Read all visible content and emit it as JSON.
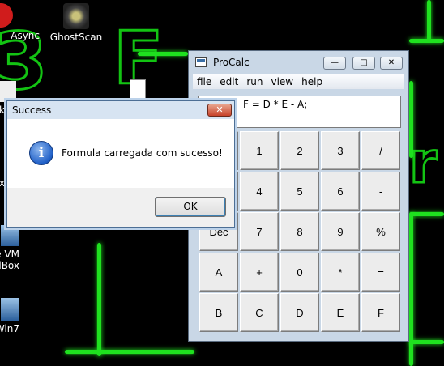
{
  "desktop": {
    "icons": [
      {
        "label": "Async",
        "icon": "async-app-icon"
      },
      {
        "label": "GhostScan",
        "icon": "ghostscan-app-icon"
      },
      {
        "label": "ck",
        "icon": "app-icon"
      },
      {
        "label": "ax",
        "icon": "app-icon"
      },
      {
        "label": "e VM",
        "label2": "alBox",
        "icon": "virtualbox-icon"
      },
      {
        "label": "Win7",
        "icon": "vm-icon"
      }
    ]
  },
  "procalc": {
    "title": "ProCalc",
    "buttons": {
      "minimize": "—",
      "maximize": "□",
      "close": "✕"
    },
    "menu": [
      "file",
      "edit",
      "run",
      "view",
      "help"
    ],
    "display": "F = D * E - A;",
    "keys": [
      [
        "",
        "1",
        "2",
        "3",
        "/"
      ],
      [
        "",
        "4",
        "5",
        "6",
        "-"
      ],
      [
        "Dec",
        "7",
        "8",
        "9",
        "%"
      ],
      [
        "A",
        "+",
        "0",
        "*",
        "="
      ],
      [
        "B",
        "C",
        "D",
        "E",
        "F"
      ]
    ]
  },
  "dialog": {
    "title": "Success",
    "close": "✕",
    "icon": "info-icon",
    "icon_glyph": "i",
    "message": "Formula carregada com sucesso!",
    "ok_label": "OK"
  },
  "colors": {
    "neon": "#1fe11f",
    "desktop": "#000000"
  }
}
